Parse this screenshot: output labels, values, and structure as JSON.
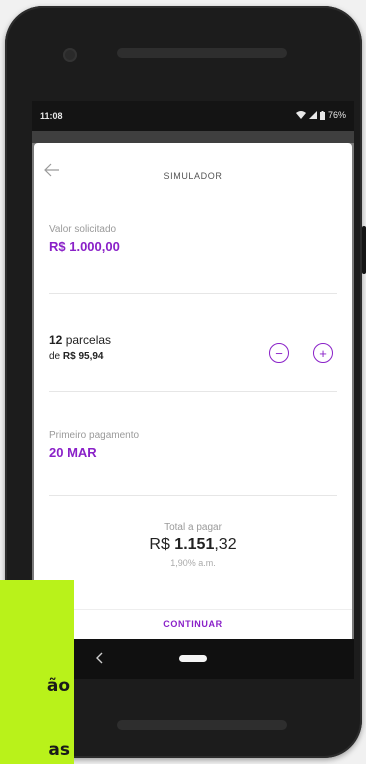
{
  "status_bar": {
    "time": "11:08",
    "battery": "76%"
  },
  "header": {
    "title": "SIMULADOR"
  },
  "valor": {
    "label": "Valor solicitado",
    "value": "R$ 1.000,00"
  },
  "parcelas": {
    "count": "12",
    "count_suffix": " parcelas",
    "prefix": "de ",
    "amount": "R$ 95,94",
    "minus": "−",
    "plus": "+"
  },
  "pagamento": {
    "label": "Primeiro pagamento",
    "date": "20 MAR"
  },
  "total": {
    "label": "Total a pagar",
    "currency": "R$ ",
    "value_bold": "1.151",
    "value_rest": ",32",
    "rate": "1,90% a.m."
  },
  "footer": {
    "continue_label": "CONTINUAR"
  },
  "overlay": {
    "line1": "ão",
    "line2": "as"
  },
  "colors": {
    "accent": "#8a21c8",
    "overlay": "#b9f21a"
  }
}
